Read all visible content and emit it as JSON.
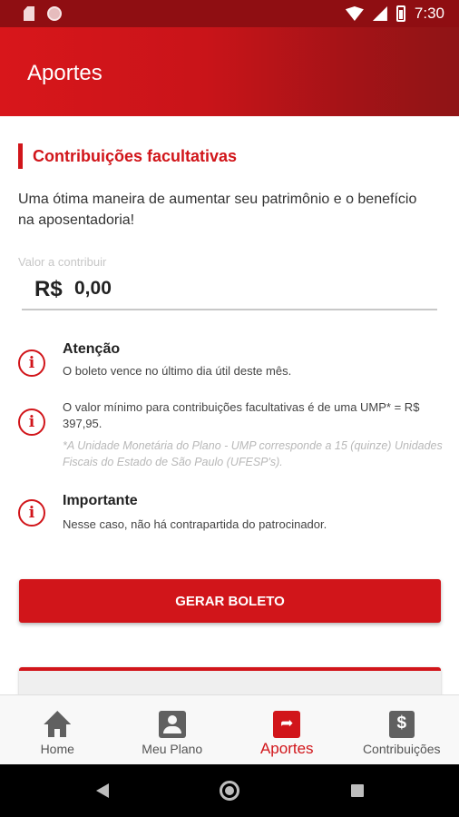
{
  "status_bar": {
    "time": "7:30"
  },
  "app_bar": {
    "title": "Aportes"
  },
  "section": {
    "title": "Contribuições facultativas",
    "intro": "Uma ótima maneira de aumentar seu patrimônio e o benefício na aposentadoria!"
  },
  "amount": {
    "label": "Valor a contribuir",
    "currency": "R$",
    "value": "0,00"
  },
  "notices": [
    {
      "title": "Atenção",
      "text": "O boleto vence no último dia útil deste mês."
    },
    {
      "text": "O valor mínimo para contribuições facultativas é de uma UMP* = R$ 397,95.",
      "footnote": "*A Unidade Monetária do Plano - UMP corresponde a 15 (quinze) Unidades Fiscais do Estado de São Paulo (UFESP's)."
    },
    {
      "title": "Importante",
      "text": "Nesse caso, não há contrapartida do patrocinador."
    }
  ],
  "primary_button": {
    "label": "GERAR BOLETO"
  },
  "bottom_nav": {
    "active": "Aportes",
    "items": [
      {
        "label": "Home",
        "icon": "home-icon"
      },
      {
        "label": "Meu Plano",
        "icon": "person-icon"
      },
      {
        "label": "Aportes",
        "icon": "share-icon"
      },
      {
        "label": "Contribuições",
        "icon": "dollar-icon"
      }
    ]
  },
  "colors": {
    "brand_red": "#d1151a",
    "status_bar": "#8f0e12",
    "nav_inactive": "#606060"
  }
}
